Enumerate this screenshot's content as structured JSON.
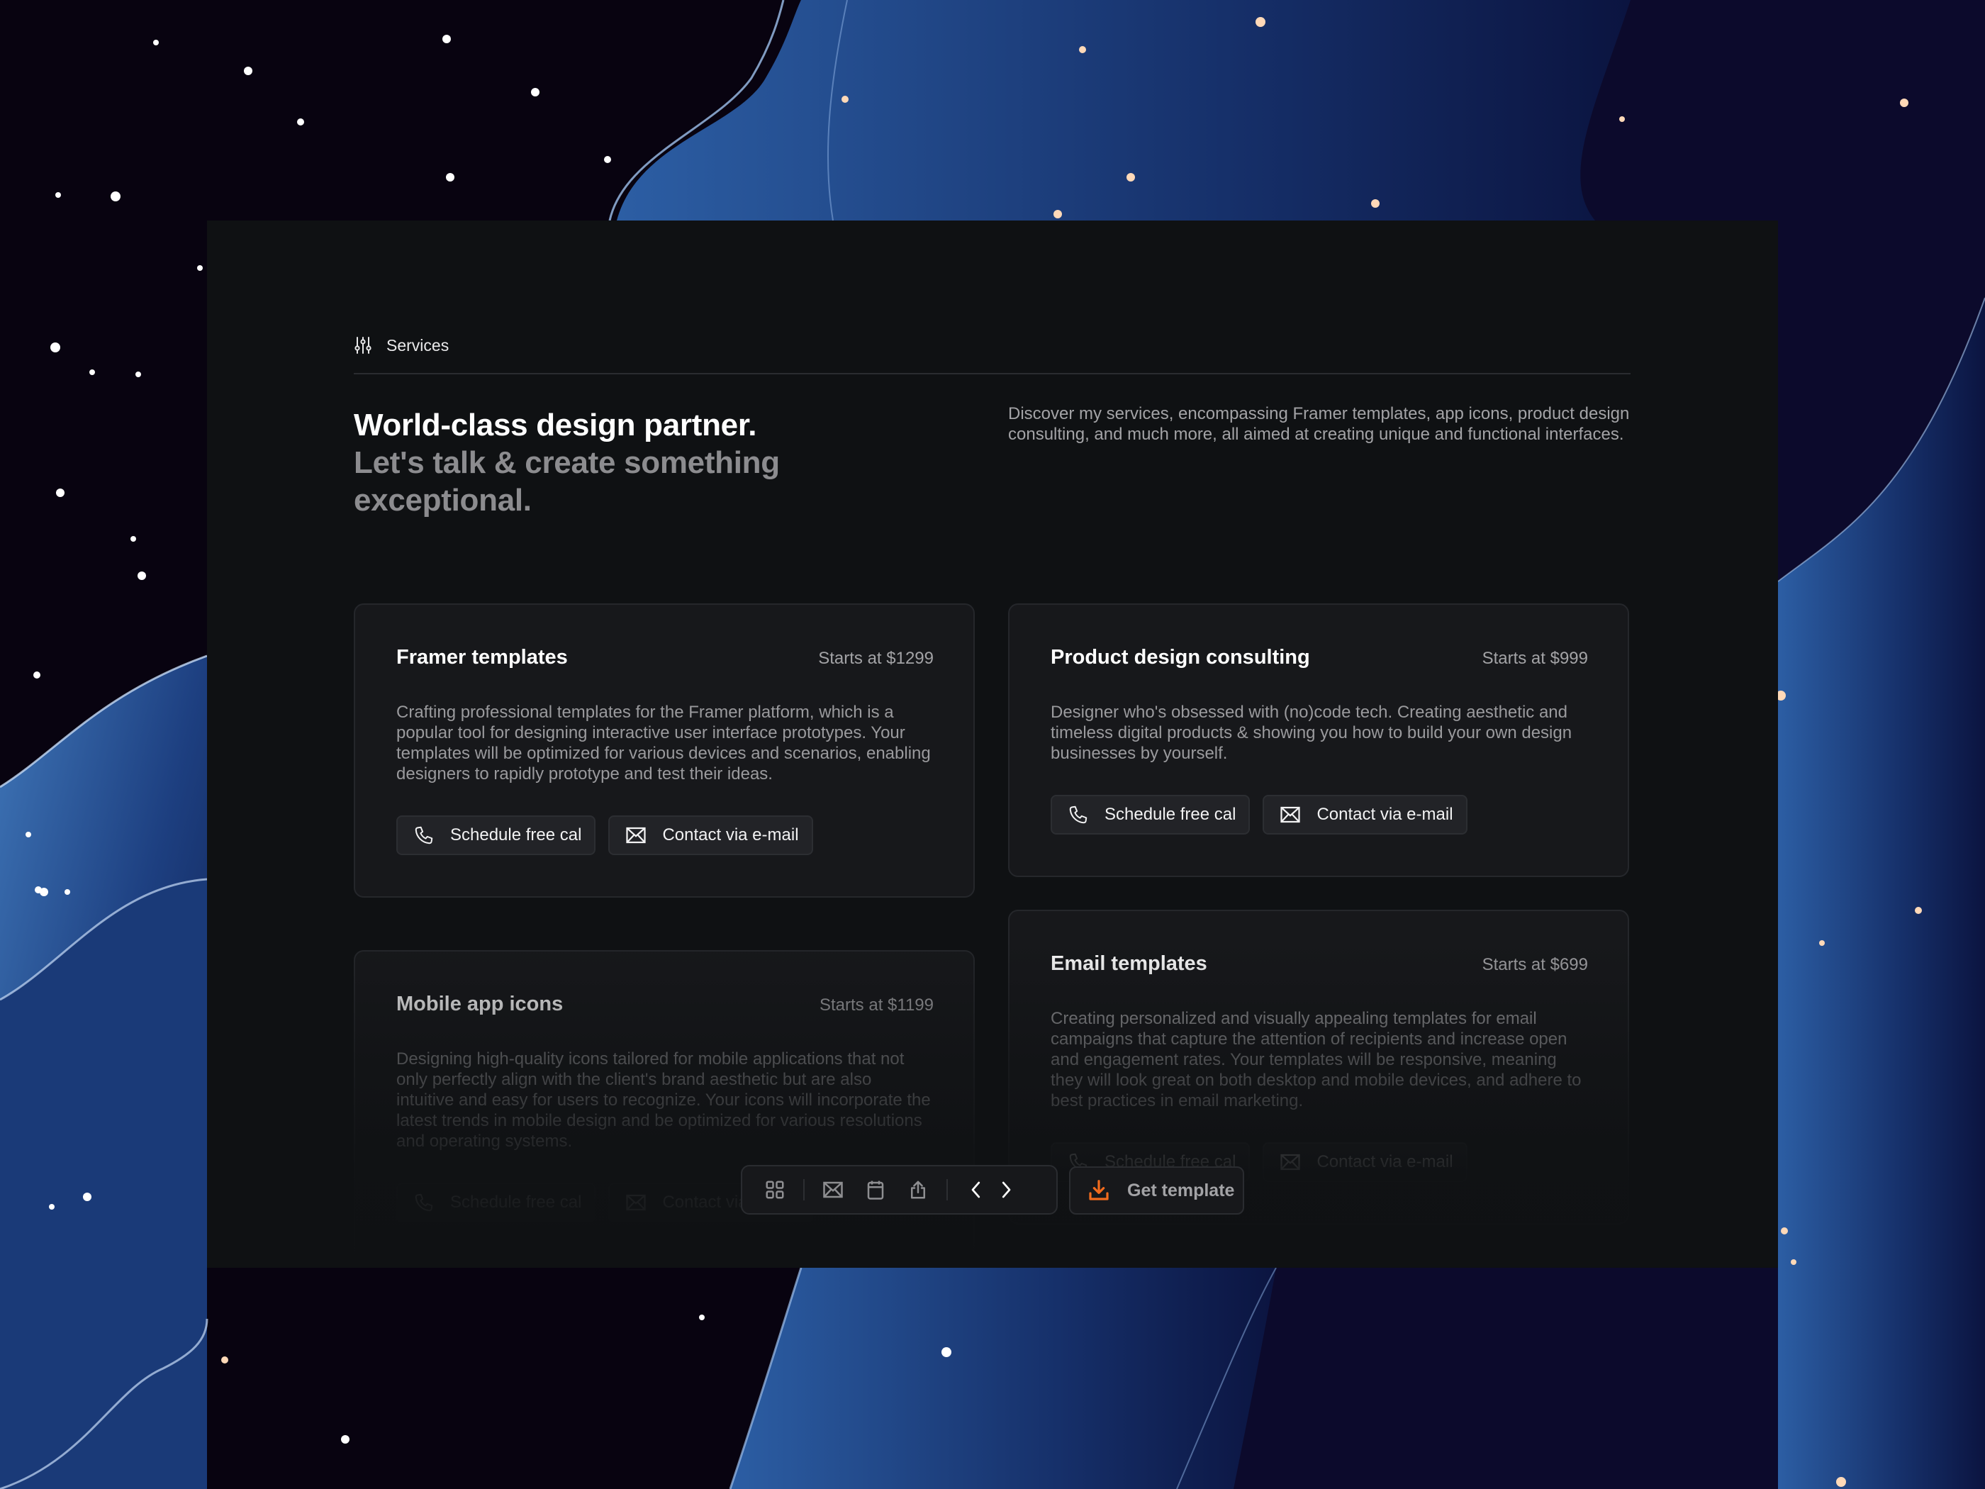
{
  "section": {
    "icon": "adjustments-sliders-icon",
    "label": "Services"
  },
  "headline": {
    "line1": "World-class design partner.",
    "line2": "Let's talk & create something exceptional."
  },
  "intro": "Discover my services, encompassing Framer templates, app icons, product design consulting, and much more, all aimed at creating unique and functional interfaces.",
  "cards": [
    {
      "title": "Framer templates",
      "price": "Starts at $1299",
      "description": "Crafting professional templates for the Framer platform, which is a popular tool for designing interactive user interface prototypes. Your templates will be optimized for various devices and scenarios, enabling designers to rapidly prototype and test their ideas.",
      "schedule_label": "Schedule free cal",
      "contact_label": "Contact via e-mail"
    },
    {
      "title": "Product design consulting",
      "price": "Starts at $999",
      "description": "Designer who's obsessed with (no)code tech. Creating aesthetic and timeless digital products & showing you how to build your own design businesses by yourself.",
      "schedule_label": "Schedule free cal",
      "contact_label": "Contact via e-mail"
    },
    {
      "title": "Mobile app icons",
      "price": "Starts at $1199",
      "description": "Designing high-quality icons tailored for mobile applications that not only perfectly align with the client's brand aesthetic but are also intuitive and easy for users to recognize. Your icons will incorporate the latest trends in mobile design and be optimized for various resolutions and operating systems.",
      "schedule_label": "Schedule free cal",
      "contact_label": "Contact via e-mail"
    },
    {
      "title": "Email templates",
      "price": "Starts at $699",
      "description": "Creating personalized and visually appealing templates for email campaigns that capture the attention of recipients and increase open and engagement rates. Your templates will be responsive, meaning they will look great on both desktop and mobile devices, and adhere to best practices in email marketing.",
      "schedule_label": "Schedule free cal",
      "contact_label": "Contact via e-mail"
    }
  ],
  "toolbar": {
    "icons": [
      "grid-icon",
      "mail-icon",
      "calendar-icon",
      "share-icon",
      "chevron-left-icon",
      "chevron-right-icon"
    ],
    "get_template_label": "Get template",
    "accent_color": "#f26b1d"
  },
  "colors": {
    "panel": "#0f1113",
    "card": "#17181b",
    "accent": "#f26b1d"
  }
}
